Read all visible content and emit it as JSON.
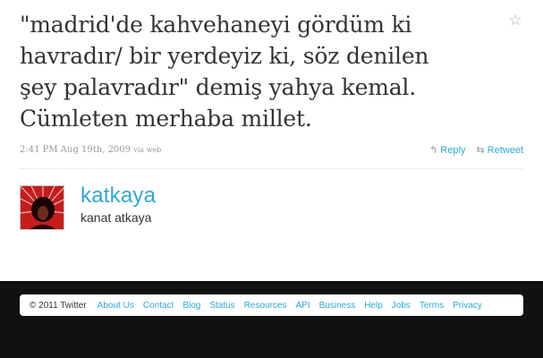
{
  "tweet": {
    "text_lines": [
      "\"madrid'de kahvehaneyi gördüm ki",
      "havradır/ bir yerdeyiz ki, söz denilen",
      "şey palavradır\" demiş yahya kemal.",
      "Cümleten merhaba millet."
    ],
    "timestamp": "2:41 PM Aug 19th, 2009",
    "via": "via web",
    "favorite_icon": "star-icon"
  },
  "actions": {
    "reply_label": "Reply",
    "reply_icon": "reply-arrow-icon",
    "retweet_label": "Retweet",
    "retweet_icon": "retweet-icon"
  },
  "author": {
    "screen_name": "katkaya",
    "full_name": "kanat atkaya"
  },
  "footer": {
    "copyright": "© 2011 Twitter",
    "links": [
      "About Us",
      "Contact",
      "Blog",
      "Status",
      "Resources",
      "API",
      "Business",
      "Help",
      "Jobs",
      "Terms",
      "Privacy"
    ]
  },
  "colors": {
    "link": "#2fa7d7",
    "text": "#333333",
    "meta": "#999999",
    "dark_band": "#111111"
  }
}
